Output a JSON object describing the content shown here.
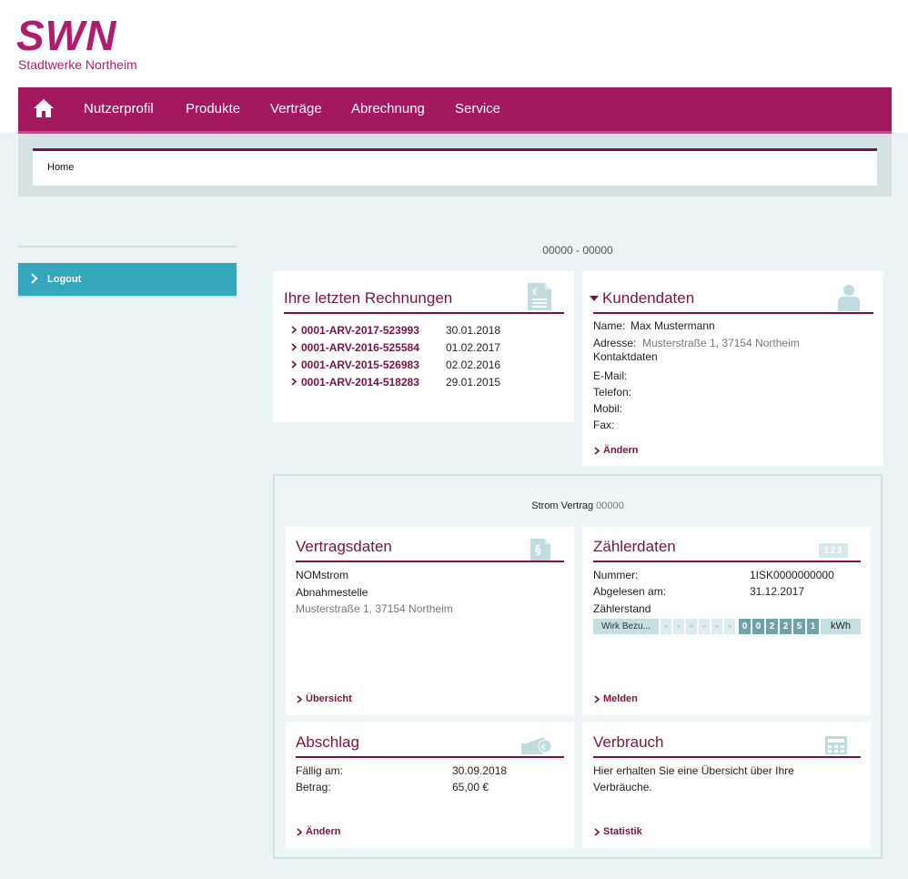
{
  "brand": {
    "name": "SWN",
    "subtitle": "Stadtwerke Northeim",
    "color": "#b01d6f"
  },
  "nav": {
    "items": [
      "Nutzerprofil",
      "Produkte",
      "Verträge",
      "Abrechnung",
      "Service"
    ]
  },
  "breadcrumb": {
    "home": "Home"
  },
  "sidebar": {
    "logout": "Logout"
  },
  "account_range": "00000 - 00000",
  "invoices": {
    "title": "Ihre letzten Rechnungen",
    "items": [
      {
        "number": "0001-ARV-2017-523993",
        "date": "30.01.2018"
      },
      {
        "number": "0001-ARV-2016-525584",
        "date": "01.02.2017"
      },
      {
        "number": "0001-ARV-2015-526983",
        "date": "02.02.2016"
      },
      {
        "number": "0001-ARV-2014-518283",
        "date": "29.01.2015"
      }
    ]
  },
  "customer": {
    "title": "Kundendaten",
    "name_label": "Name:",
    "name": "Max Mustermann",
    "address_label": "Adresse:",
    "address": "Musterstraße 1, 37154 Northeim",
    "contact_heading": "Kontaktdaten",
    "email_label": "E-Mail:",
    "phone_label": "Telefon:",
    "mobile_label": "Mobil:",
    "fax_label": "Fax:",
    "edit": "Ändern"
  },
  "contract": {
    "title_prefix": "Strom Vertrag",
    "title_number": "00000"
  },
  "contract_data": {
    "title": "Vertragsdaten",
    "product": "NOMstrom",
    "location_label": "Abnahmestelle",
    "location": "Musterstraße 1, 37154 Northeim",
    "link": "Übersicht"
  },
  "meter": {
    "title": "Zählerdaten",
    "icon_text": "123",
    "number_label": "Nummer:",
    "number": "1ISK0000000000",
    "read_label": "Abgelesen am:",
    "read_date": "31.12.2017",
    "reading_label": "Zählerstand",
    "register": "Wirk Bezu...",
    "blank_digits": [
      "-",
      "-",
      "-",
      "-",
      "-",
      "-"
    ],
    "digits": [
      "0",
      "0",
      "2",
      "2",
      "5",
      "1"
    ],
    "unit": "kWh",
    "link": "Melden"
  },
  "installment": {
    "title": "Abschlag",
    "due_label": "Fällig am:",
    "due_date": "30.09.2018",
    "amount_label": "Betrag:",
    "amount": "65,00 €",
    "link": "Ändern"
  },
  "consumption": {
    "title": "Verbrauch",
    "text_line1": "Hier erhalten Sie eine Übersicht über Ihre",
    "text_line2": "Verbräuche.",
    "link": "Statistik"
  },
  "colors": {
    "nav": "#a3185f",
    "accent": "#7a1244",
    "logout": "#35a8bd",
    "icon": "#bfdde0"
  }
}
